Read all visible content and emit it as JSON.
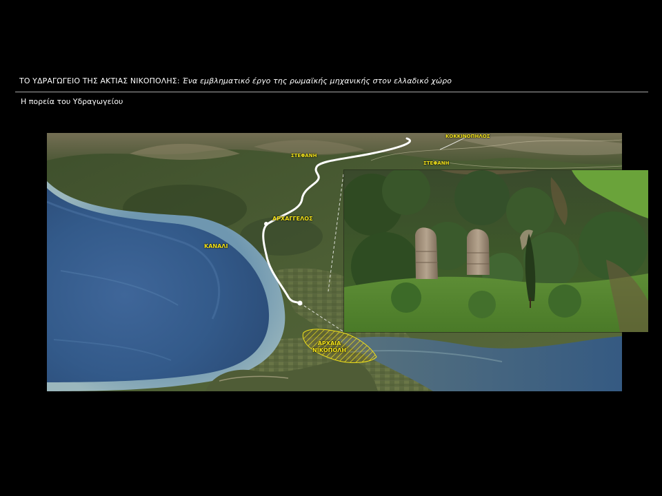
{
  "slide": {
    "title_main": "ΤΟ ΥΔΡΑΓΩΓΕΙΟ ΤΗΣ ΑΚΤΙΑΣ ΝΙΚΟΠΟΛΗΣ:",
    "title_sub": "Ένα εμβληματικό έργο της ρωμαϊκής μηχανικής στον ελλαδικό χώρο",
    "subtitle": "Η πορεία του Υδραγωγείου"
  },
  "map": {
    "labels": {
      "kokkinopilos": "ΚΟΚΚΙΝΟΠΗΛΟΣ",
      "stefani_top": "ΣΤΕΦΑΝΗ",
      "stefani_right": "ΣΤΕΦΑΝΗ",
      "archangelos": "ΑΡΧΑΓΓΕΛΟΣ",
      "kanali": "ΚΑΝΑΛΙ",
      "nikopoli_line1": "ΑΡΧΑΙΑ",
      "nikopoli_line2": "ΝΙΚΟΠΟΛΗ"
    },
    "colors": {
      "label": "#f2e21a",
      "route": "#ffffff",
      "sea": "#3a5e8e"
    }
  }
}
